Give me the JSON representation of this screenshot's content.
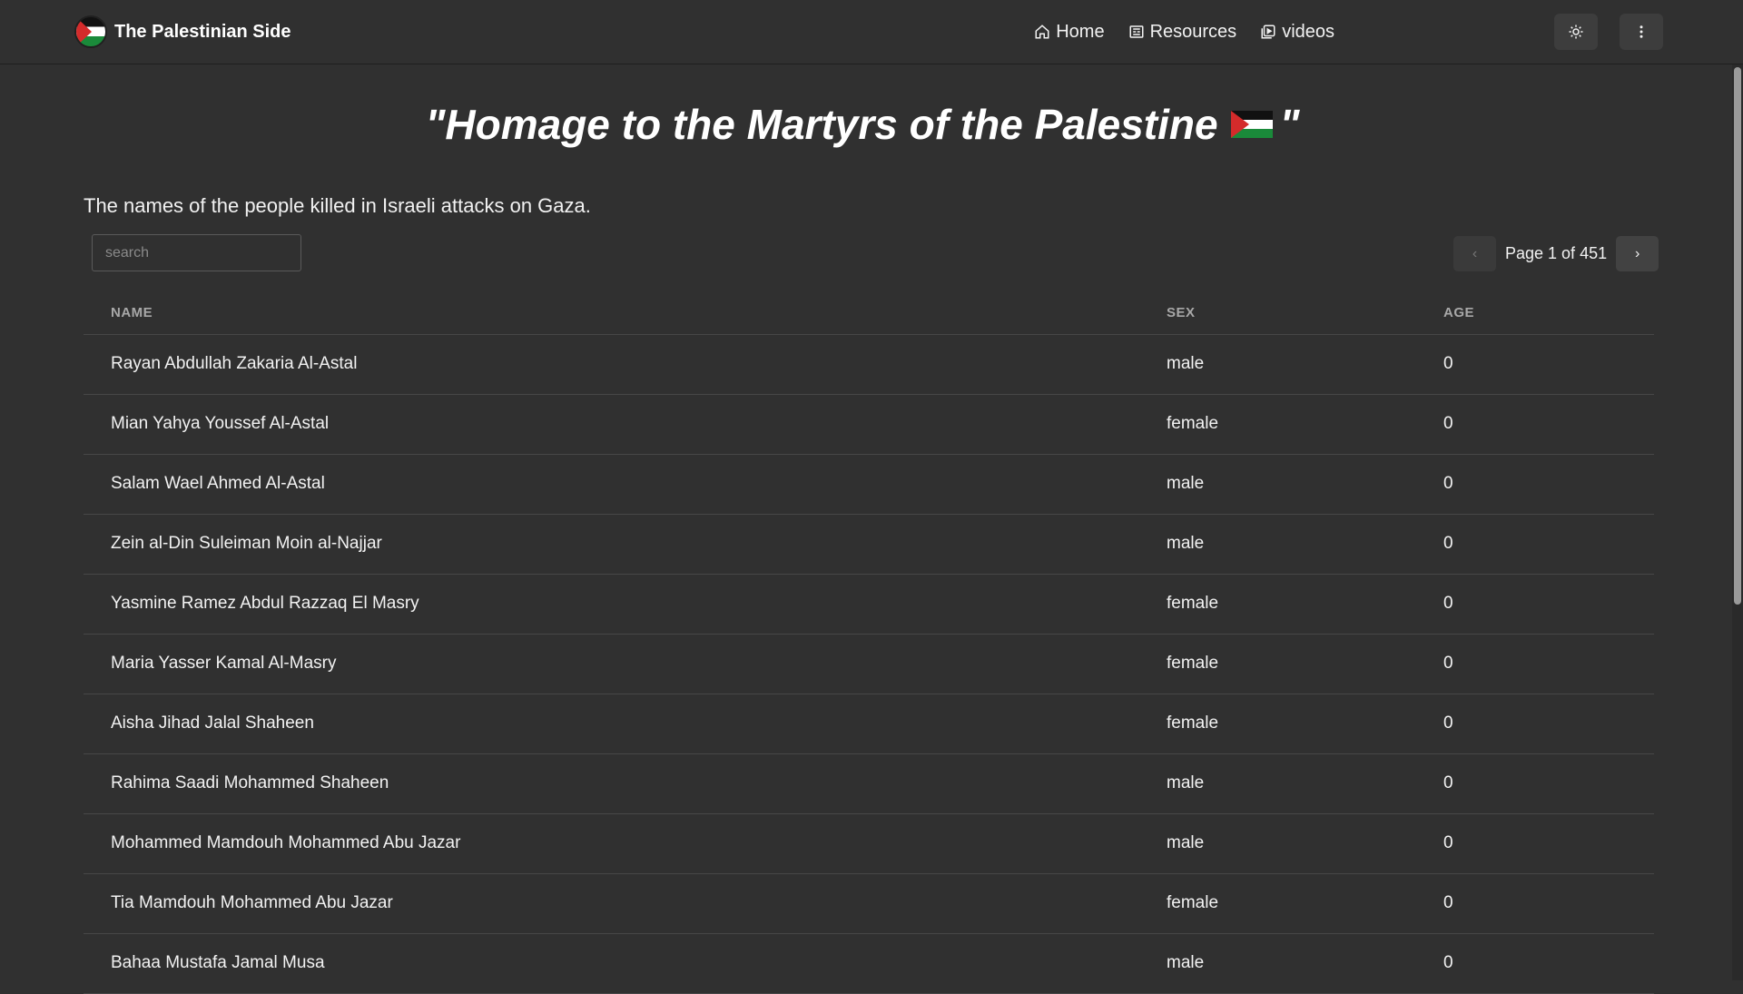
{
  "brand": {
    "name": "The Palestinian Side"
  },
  "nav": {
    "home": "Home",
    "resources": "Resources",
    "videos": "videos"
  },
  "icons": {
    "brand": "palestine-flag-icon",
    "home": "home-icon",
    "resources": "newspaper-icon",
    "videos": "video-icon",
    "theme": "sun-icon",
    "menu": "vertical-dots-icon",
    "prev": "chevron-left-icon",
    "next": "chevron-right-icon"
  },
  "page": {
    "title_open": "\"Homage to the Martyrs of the Palestine",
    "title_close": "\"",
    "subtitle": "The names of the people killed in Israeli attacks on Gaza."
  },
  "search": {
    "placeholder": "search"
  },
  "pager": {
    "text": "Page 1 of 451",
    "prev": "‹",
    "next": "›"
  },
  "table": {
    "headers": {
      "name": "NAME",
      "sex": "SEX",
      "age": "AGE"
    },
    "rows": [
      {
        "name": "Rayan Abdullah Zakaria Al-Astal",
        "sex": "male",
        "age": "0"
      },
      {
        "name": "Mian Yahya Youssef Al-Astal",
        "sex": "female",
        "age": "0"
      },
      {
        "name": "Salam Wael Ahmed Al-Astal",
        "sex": "male",
        "age": "0"
      },
      {
        "name": "Zein al-Din Suleiman Moin al-Najjar",
        "sex": "male",
        "age": "0"
      },
      {
        "name": "Yasmine Ramez Abdul Razzaq El Masry",
        "sex": "female",
        "age": "0"
      },
      {
        "name": "Maria Yasser Kamal Al-Masry",
        "sex": "female",
        "age": "0"
      },
      {
        "name": "Aisha Jihad Jalal Shaheen",
        "sex": "female",
        "age": "0"
      },
      {
        "name": "Rahima Saadi Mohammed Shaheen",
        "sex": "male",
        "age": "0"
      },
      {
        "name": "Mohammed Mamdouh Mohammed Abu Jazar",
        "sex": "male",
        "age": "0"
      },
      {
        "name": "Tia Mamdouh Mohammed Abu Jazar",
        "sex": "female",
        "age": "0"
      },
      {
        "name": "Bahaa Mustafa Jamal Musa",
        "sex": "male",
        "age": "0"
      }
    ]
  }
}
